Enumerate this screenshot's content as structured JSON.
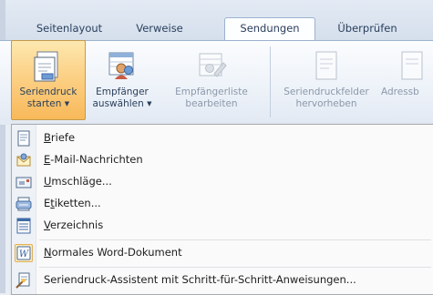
{
  "tabs": [
    {
      "label": "Seitenlayout",
      "active": false
    },
    {
      "label": "Verweise",
      "active": false
    },
    {
      "label": "Sendungen",
      "active": true
    },
    {
      "label": "Überprüfen",
      "active": false
    }
  ],
  "ribbon": {
    "buttons": [
      {
        "line1": "Seriendruck",
        "line2": "starten",
        "dropdown": true,
        "icon": "document-mailmerge-icon",
        "state": "pressed"
      },
      {
        "line1": "Empfänger",
        "line2": "auswählen",
        "dropdown": true,
        "icon": "recipients-icon",
        "state": "normal"
      },
      {
        "line1": "Empfängerliste",
        "line2": "bearbeiten",
        "dropdown": false,
        "icon": "edit-list-icon",
        "state": "disabled"
      },
      {
        "line1": "Seriendruckfelder",
        "line2": "hervorheben",
        "dropdown": false,
        "icon": "highlight-fields-icon",
        "state": "disabled"
      },
      {
        "line1": "Adressb",
        "line2": "",
        "dropdown": false,
        "icon": "address-block-icon",
        "state": "disabled"
      }
    ]
  },
  "menu": {
    "items": [
      {
        "pre": "",
        "mnemonic": "B",
        "post": "riefe",
        "icon": "letter-icon",
        "selected": false
      },
      {
        "pre": "",
        "mnemonic": "E",
        "post": "-Mail-Nachrichten",
        "icon": "email-icon",
        "selected": false
      },
      {
        "pre": "",
        "mnemonic": "U",
        "post": "mschläge...",
        "icon": "envelope-icon",
        "selected": false
      },
      {
        "pre": "E",
        "mnemonic": "t",
        "post": "iketten...",
        "icon": "labels-icon",
        "selected": false
      },
      {
        "pre": "",
        "mnemonic": "V",
        "post": "erzeichnis",
        "icon": "directory-icon",
        "selected": false
      },
      {
        "pre": "",
        "mnemonic": "N",
        "post": "ormales Word-Dokument",
        "icon": "word-document-icon",
        "selected": true
      },
      {
        "pre": "",
        "mnemonic": "",
        "post": "Seriendruck-Assistent mit Schritt-für-Schritt-Anweisungen...",
        "icon": "wizard-icon",
        "selected": false
      }
    ]
  },
  "colors": {
    "pressed_button": "#f8b95a",
    "selected_item": "#fde9b6",
    "menu_background": "#fafafa"
  }
}
